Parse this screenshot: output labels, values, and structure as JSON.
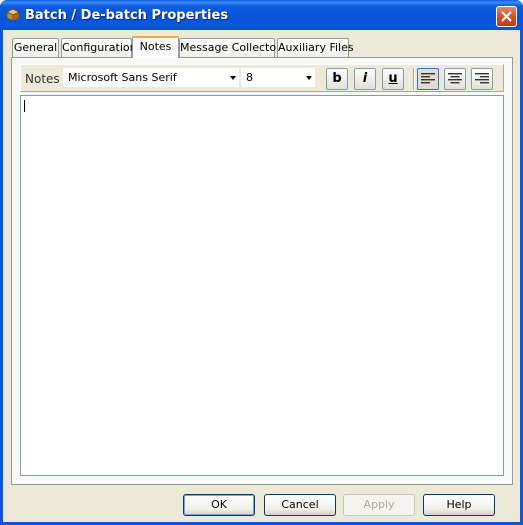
{
  "window": {
    "title": "Batch / De-batch Properties"
  },
  "tabs": [
    {
      "label": "General"
    },
    {
      "label": "Configuration"
    },
    {
      "label": "Notes"
    },
    {
      "label": "Message Collector"
    },
    {
      "label": "Auxiliary Files"
    }
  ],
  "active_tab": "Notes",
  "toolbar": {
    "label": "Notes",
    "font_name": "Microsoft Sans Serif",
    "font_size": "8",
    "bold": "b",
    "italic": "i",
    "underline": "u",
    "alignment": "left"
  },
  "editor": {
    "value": ""
  },
  "buttons": {
    "ok": "OK",
    "cancel": "Cancel",
    "apply": "Apply",
    "help": "Help"
  },
  "colors": {
    "titlebar": "#0a57e0",
    "dialog_bg": "#ece9d8",
    "active_tab_accent": "#fda436"
  }
}
